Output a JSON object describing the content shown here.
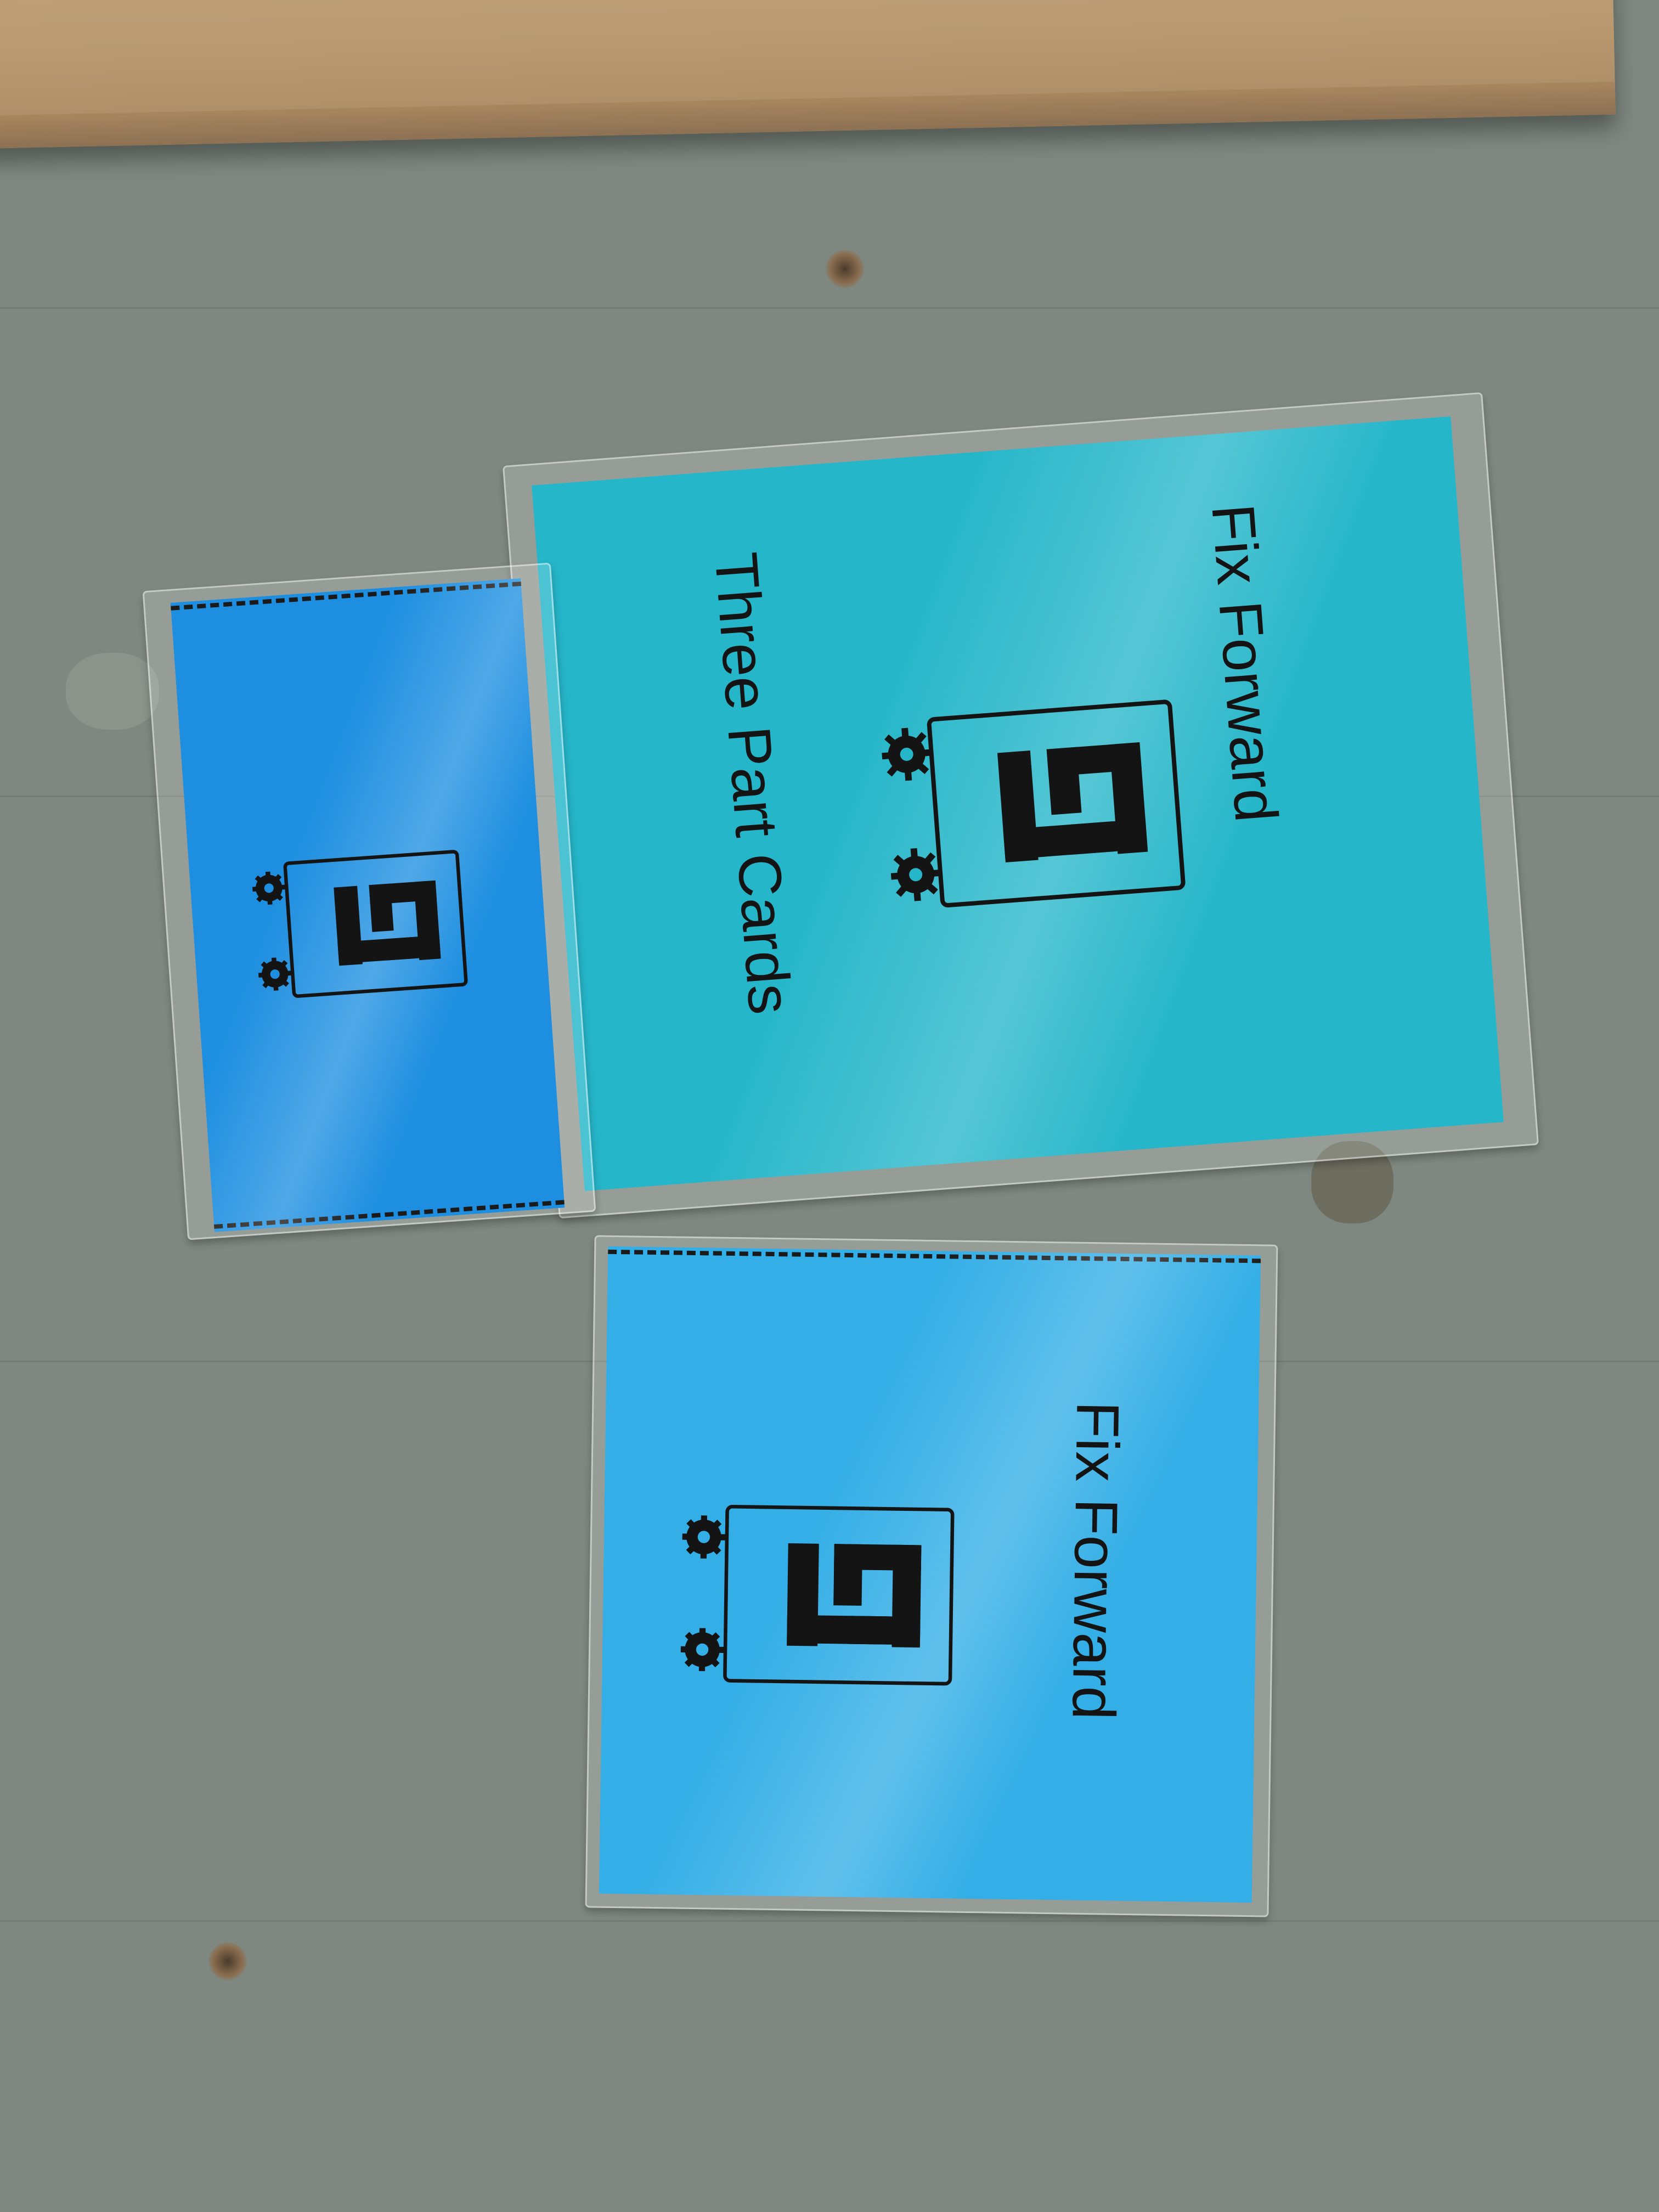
{
  "cards": {
    "large": {
      "title": "Fix Forward",
      "subtitle": "Three Part Cards",
      "color": "#25b6c9"
    },
    "small": {
      "color": "#1e8fe0"
    },
    "medium": {
      "title": "Fix Forward",
      "color": "#33aee6"
    }
  },
  "logo": {
    "name": "fix-forward-logo",
    "description_icon": "ff-monogram-with-gears-icon"
  },
  "colors": {
    "surface": "#7f8880",
    "wood": "#c7a884",
    "ink": "#141414"
  }
}
